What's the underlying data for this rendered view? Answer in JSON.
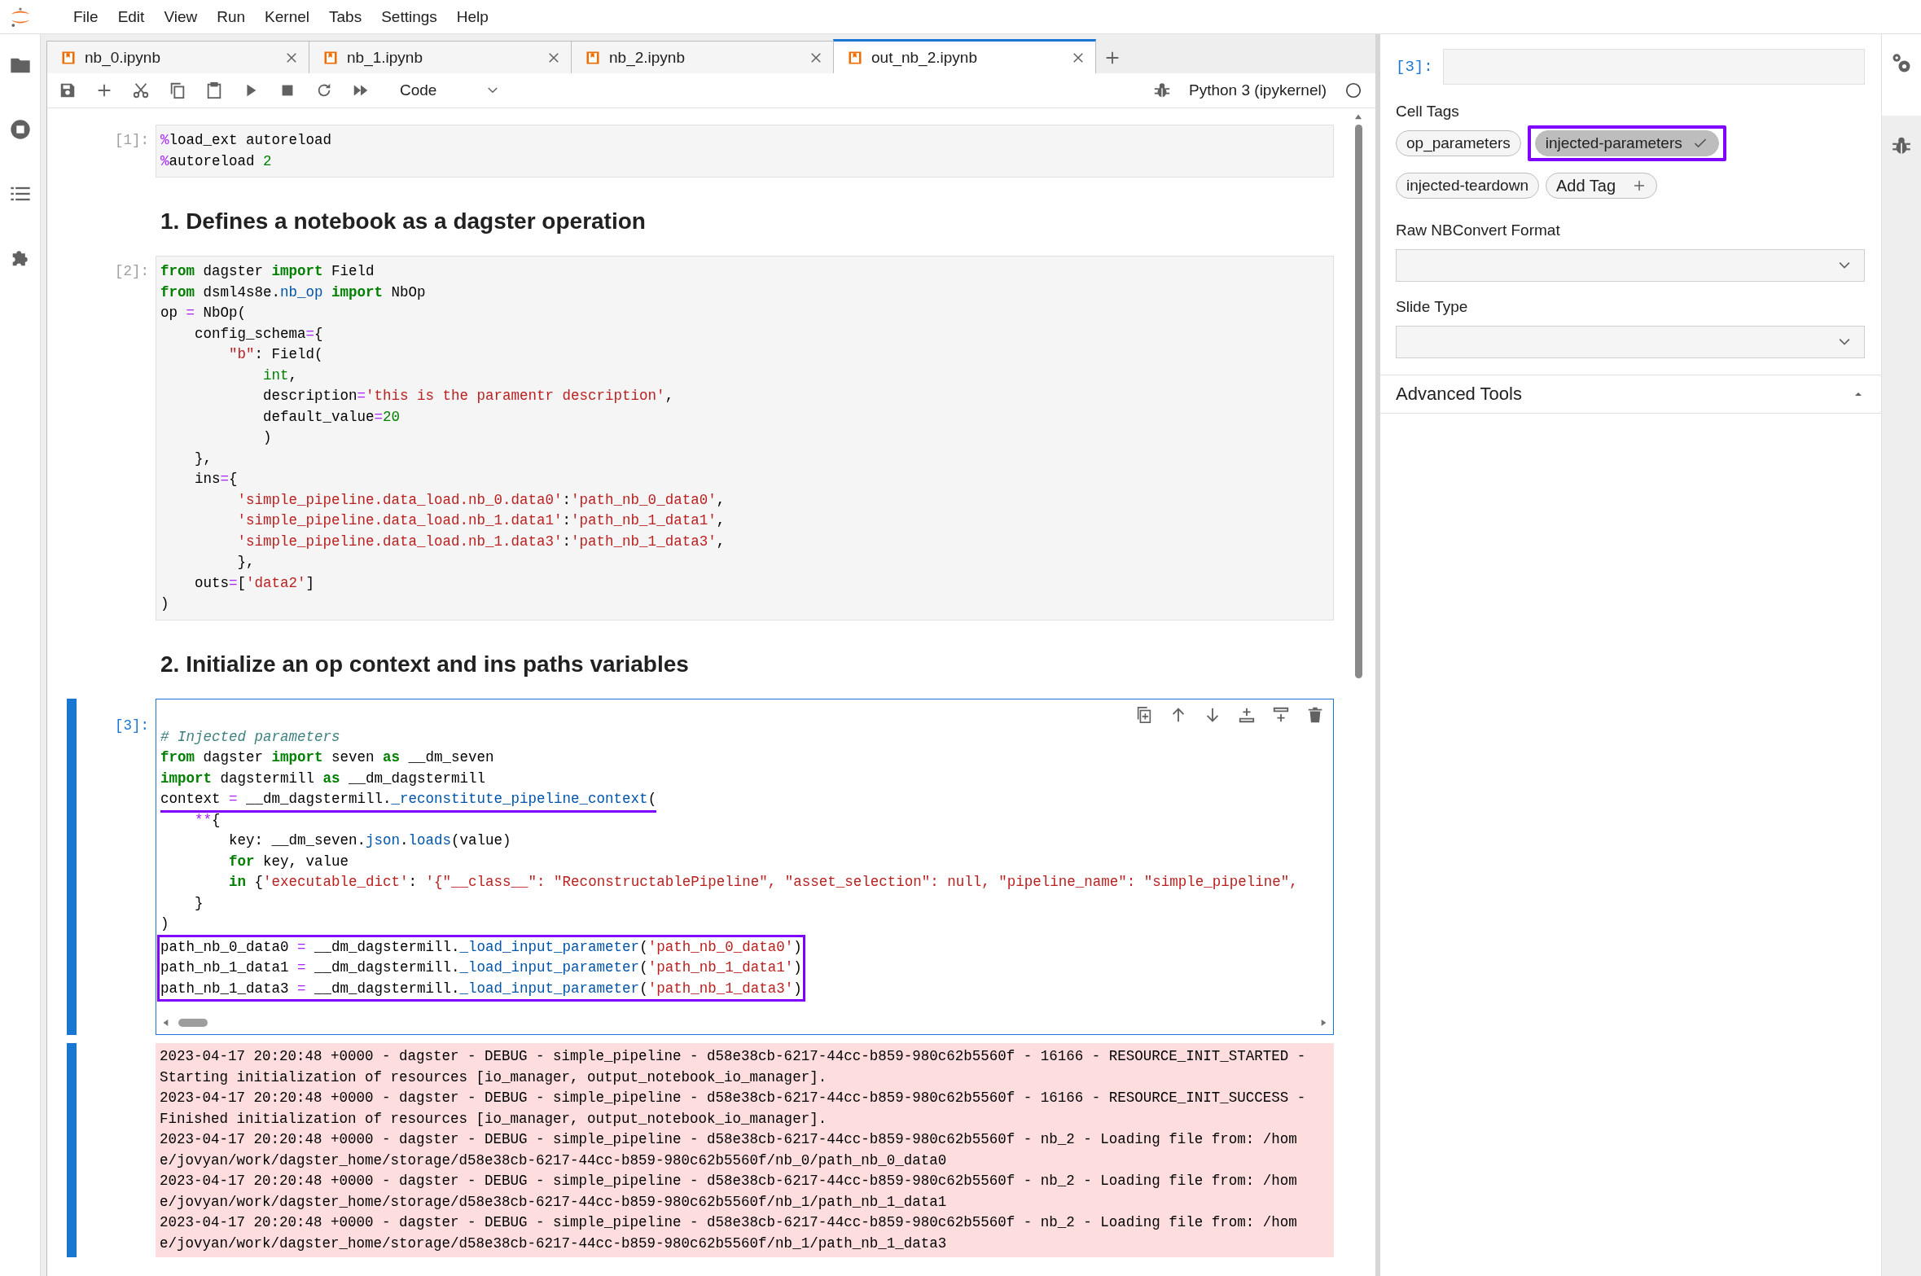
{
  "menu": [
    "File",
    "Edit",
    "View",
    "Run",
    "Kernel",
    "Tabs",
    "Settings",
    "Help"
  ],
  "tabs": [
    {
      "label": "nb_0.ipynb",
      "selected": false
    },
    {
      "label": "nb_1.ipynb",
      "selected": false
    },
    {
      "label": "nb_2.ipynb",
      "selected": false
    },
    {
      "label": "out_nb_2.ipynb",
      "selected": true
    }
  ],
  "toolbar": {
    "cell_type": "Code",
    "kernel": "Python 3 (ipykernel)"
  },
  "cells": [
    {
      "kind": "code",
      "prompt": "[1]:",
      "selected": false,
      "lines": [
        {
          "tokens": [
            {
              "kind": "magic",
              "text": "%"
            },
            "load_ext autoreload"
          ]
        },
        {
          "tokens": [
            {
              "kind": "magic",
              "text": "%"
            },
            "autoreload ",
            {
              "kind": "number",
              "text": "2"
            }
          ]
        }
      ]
    },
    {
      "kind": "markdown",
      "heading": "1. Defines a notebook as a dagster operation"
    },
    {
      "kind": "code",
      "prompt": "[2]:",
      "selected": false,
      "lines": [
        {
          "tokens": [
            {
              "kind": "keyword",
              "text": "from"
            },
            " dagster ",
            {
              "kind": "keyword",
              "text": "import"
            },
            " Field"
          ]
        },
        {
          "tokens": [
            {
              "kind": "keyword",
              "text": "from"
            },
            " dsml4s8e.",
            {
              "kind": "property",
              "text": "nb_op"
            },
            {
              "kind": "keyword",
              "text": " import"
            },
            " NbOp"
          ]
        },
        {
          "tokens": [
            "op ",
            {
              "kind": "operator",
              "text": "="
            },
            " NbOp("
          ]
        },
        {
          "tokens": [
            "    config_schema",
            {
              "kind": "operator",
              "text": "="
            },
            "{"
          ]
        },
        {
          "tokens": [
            {
              "kind": "string",
              "text": "        \"b\""
            },
            ": Field("
          ]
        },
        {
          "tokens": [
            {
              "kind": "builtin",
              "text": "            int"
            },
            ","
          ]
        },
        {
          "tokens": [
            "            description",
            {
              "kind": "operator",
              "text": "="
            },
            {
              "kind": "string",
              "text": "'this is the paramentr description'"
            },
            ","
          ]
        },
        {
          "tokens": [
            "            default_value",
            {
              "kind": "operator",
              "text": "="
            },
            {
              "kind": "number",
              "text": "20"
            }
          ]
        },
        {
          "tokens": [
            "            )"
          ]
        },
        {
          "tokens": [
            "    },"
          ]
        },
        {
          "tokens": [
            "    ins",
            {
              "kind": "operator",
              "text": "="
            },
            "{"
          ]
        },
        {
          "tokens": [
            {
              "kind": "string",
              "text": "         'simple_pipeline.data_load.nb_0.data0'"
            },
            ":",
            {
              "kind": "string",
              "text": "'path_nb_0_data0'"
            },
            ","
          ]
        },
        {
          "tokens": [
            {
              "kind": "string",
              "text": "         'simple_pipeline.data_load.nb_1.data1'"
            },
            ":",
            {
              "kind": "string",
              "text": "'path_nb_1_data1'"
            },
            ","
          ]
        },
        {
          "tokens": [
            {
              "kind": "string",
              "text": "         'simple_pipeline.data_load.nb_1.data3'"
            },
            ":",
            {
              "kind": "string",
              "text": "'path_nb_1_data3'"
            },
            ","
          ]
        },
        {
          "tokens": [
            "         },"
          ]
        },
        {
          "tokens": [
            "    outs",
            {
              "kind": "operator",
              "text": "="
            },
            "[",
            {
              "kind": "string",
              "text": "'data2'"
            },
            "]"
          ]
        },
        {
          "tokens": [
            ")"
          ]
        }
      ]
    },
    {
      "kind": "markdown",
      "heading": "2. Initialize an op context and ins paths variables"
    },
    {
      "kind": "code",
      "prompt": "[3]:",
      "selected": true,
      "lines": [
        {
          "tokens": [
            {
              "kind": "comment",
              "text": "# Injected parameters"
            }
          ],
          "underlined": false,
          "boxed": false
        },
        {
          "tokens": [
            {
              "kind": "keyword",
              "text": "from"
            },
            " dagster ",
            {
              "kind": "keyword",
              "text": "import"
            },
            " seven ",
            {
              "kind": "keyword",
              "text": "as"
            },
            " __dm_seven"
          ],
          "underlined": false,
          "boxed": false
        },
        {
          "tokens": [
            {
              "kind": "keyword",
              "text": "import"
            },
            " dagstermill ",
            {
              "kind": "keyword",
              "text": "as"
            },
            " __dm_dagstermill"
          ],
          "underlined": false,
          "boxed": false
        },
        {
          "tokens": [
            "context ",
            {
              "kind": "operator",
              "text": "="
            },
            " __dm_dagstermill.",
            {
              "kind": "property",
              "text": "_reconstitute_pipeline_context"
            },
            "("
          ],
          "underlined": true,
          "boxed": false
        },
        {
          "tokens": [
            {
              "kind": "operator",
              "text": "    **"
            },
            "{"
          ],
          "underlined": false,
          "boxed": false
        },
        {
          "tokens": [
            "        key: __dm_seven.",
            {
              "kind": "property",
              "text": "json"
            },
            ".",
            {
              "kind": "property",
              "text": "loads"
            },
            "(value)"
          ],
          "underlined": false,
          "boxed": false
        },
        {
          "tokens": [
            {
              "kind": "keyword",
              "text": "        for"
            },
            " key, value"
          ],
          "underlined": false,
          "boxed": false
        },
        {
          "tokens": [
            {
              "kind": "keyword",
              "text": "        in"
            },
            " {",
            {
              "kind": "string",
              "text": "'executable_dict'"
            },
            ": ",
            {
              "kind": "string",
              "text": "'{\"__class__\": \"ReconstructablePipeline\", \"asset_selection\": null, \"pipeline_name\": \"simple_pipeline\","
            }
          ],
          "underlined": false,
          "boxed": false
        },
        {
          "tokens": [
            "    }"
          ],
          "underlined": false,
          "boxed": false
        },
        {
          "tokens": [
            ")"
          ],
          "underlined": false,
          "boxed": false
        },
        {
          "tokens": [
            "path_nb_0_data0 ",
            {
              "kind": "operator",
              "text": "="
            },
            " __dm_dagstermill.",
            {
              "kind": "property",
              "text": "_load_input_parameter"
            },
            "(",
            {
              "kind": "string",
              "text": "'path_nb_0_data0'"
            },
            ")"
          ],
          "underlined": false,
          "boxed": true
        },
        {
          "tokens": [
            "path_nb_1_data1 ",
            {
              "kind": "operator",
              "text": "="
            },
            " __dm_dagstermill.",
            {
              "kind": "property",
              "text": "_load_input_parameter"
            },
            "(",
            {
              "kind": "string",
              "text": "'path_nb_1_data1'"
            },
            ")"
          ],
          "underlined": false,
          "boxed": true
        },
        {
          "tokens": [
            "path_nb_1_data3 ",
            {
              "kind": "operator",
              "text": "="
            },
            " __dm_dagstermill.",
            {
              "kind": "property",
              "text": "_load_input_parameter"
            },
            "(",
            {
              "kind": "string",
              "text": "'path_nb_1_data3'"
            },
            ")"
          ],
          "underlined": false,
          "boxed": true
        }
      ],
      "output": {
        "kind": "stderr",
        "lines": [
          "2023-04-17 20:20:48 +0000 - dagster - DEBUG - simple_pipeline - d58e38cb-6217-44cc-b859-980c62b5560f - 16166 - RESOURCE_INIT_STARTED -",
          "Starting initialization of resources [io_manager, output_notebook_io_manager].",
          "2023-04-17 20:20:48 +0000 - dagster - DEBUG - simple_pipeline - d58e38cb-6217-44cc-b859-980c62b5560f - 16166 - RESOURCE_INIT_SUCCESS -",
          "Finished initialization of resources [io_manager, output_notebook_io_manager].",
          "2023-04-17 20:20:48 +0000 - dagster - DEBUG - simple_pipeline - d58e38cb-6217-44cc-b859-980c62b5560f - nb_2 - Loading file from: /hom",
          "e/jovyan/work/dagster_home/storage/d58e38cb-6217-44cc-b859-980c62b5560f/nb_0/path_nb_0_data0",
          "2023-04-17 20:20:48 +0000 - dagster - DEBUG - simple_pipeline - d58e38cb-6217-44cc-b859-980c62b5560f - nb_2 - Loading file from: /hom",
          "e/jovyan/work/dagster_home/storage/d58e38cb-6217-44cc-b859-980c62b5560f/nb_1/path_nb_1_data1",
          "2023-04-17 20:20:48 +0000 - dagster - DEBUG - simple_pipeline - d58e38cb-6217-44cc-b859-980c62b5560f - nb_2 - Loading file from: /hom",
          "e/jovyan/work/dagster_home/storage/d58e38cb-6217-44cc-b859-980c62b5560f/nb_1/path_nb_1_data3"
        ]
      }
    }
  ],
  "inspector": {
    "prompt": "[3]:",
    "tags_label": "Cell Tags",
    "tags": [
      {
        "label": "op_parameters",
        "selected": false,
        "highlighted": false
      },
      {
        "label": "injected-parameters",
        "selected": true,
        "highlighted": true
      },
      {
        "label": "injected-teardown",
        "selected": false,
        "highlighted": false
      }
    ],
    "add_tag": "Add Tag",
    "fields": [
      {
        "label": "Raw NBConvert Format"
      },
      {
        "label": "Slide Type"
      }
    ],
    "advanced": {
      "label": "Advanced Tools",
      "expanded": false
    }
  }
}
